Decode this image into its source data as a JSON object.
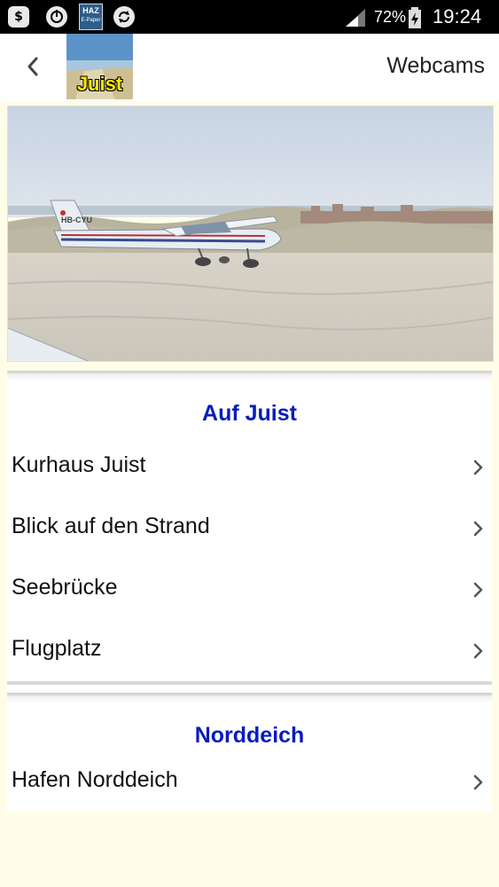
{
  "statusbar": {
    "battery": "72%",
    "time": "19:24",
    "haz_icon_title": "HAZ",
    "haz_icon_sub": "E-Paper"
  },
  "appbar": {
    "title": "Webcams",
    "logo_text": "Juist"
  },
  "sections": [
    {
      "title": "Auf Juist",
      "items": [
        {
          "label": "Kurhaus Juist"
        },
        {
          "label": "Blick auf den Strand"
        },
        {
          "label": "Seebrücke"
        },
        {
          "label": "Flugplatz"
        }
      ]
    },
    {
      "title": "Norddeich",
      "items": [
        {
          "label": "Hafen Norddeich"
        }
      ]
    }
  ],
  "hero": {
    "plane_registration": "HB-CYU"
  },
  "colors": {
    "background": "#fffde8",
    "section_title": "#0a1bbf",
    "statusbar": "#000000"
  }
}
